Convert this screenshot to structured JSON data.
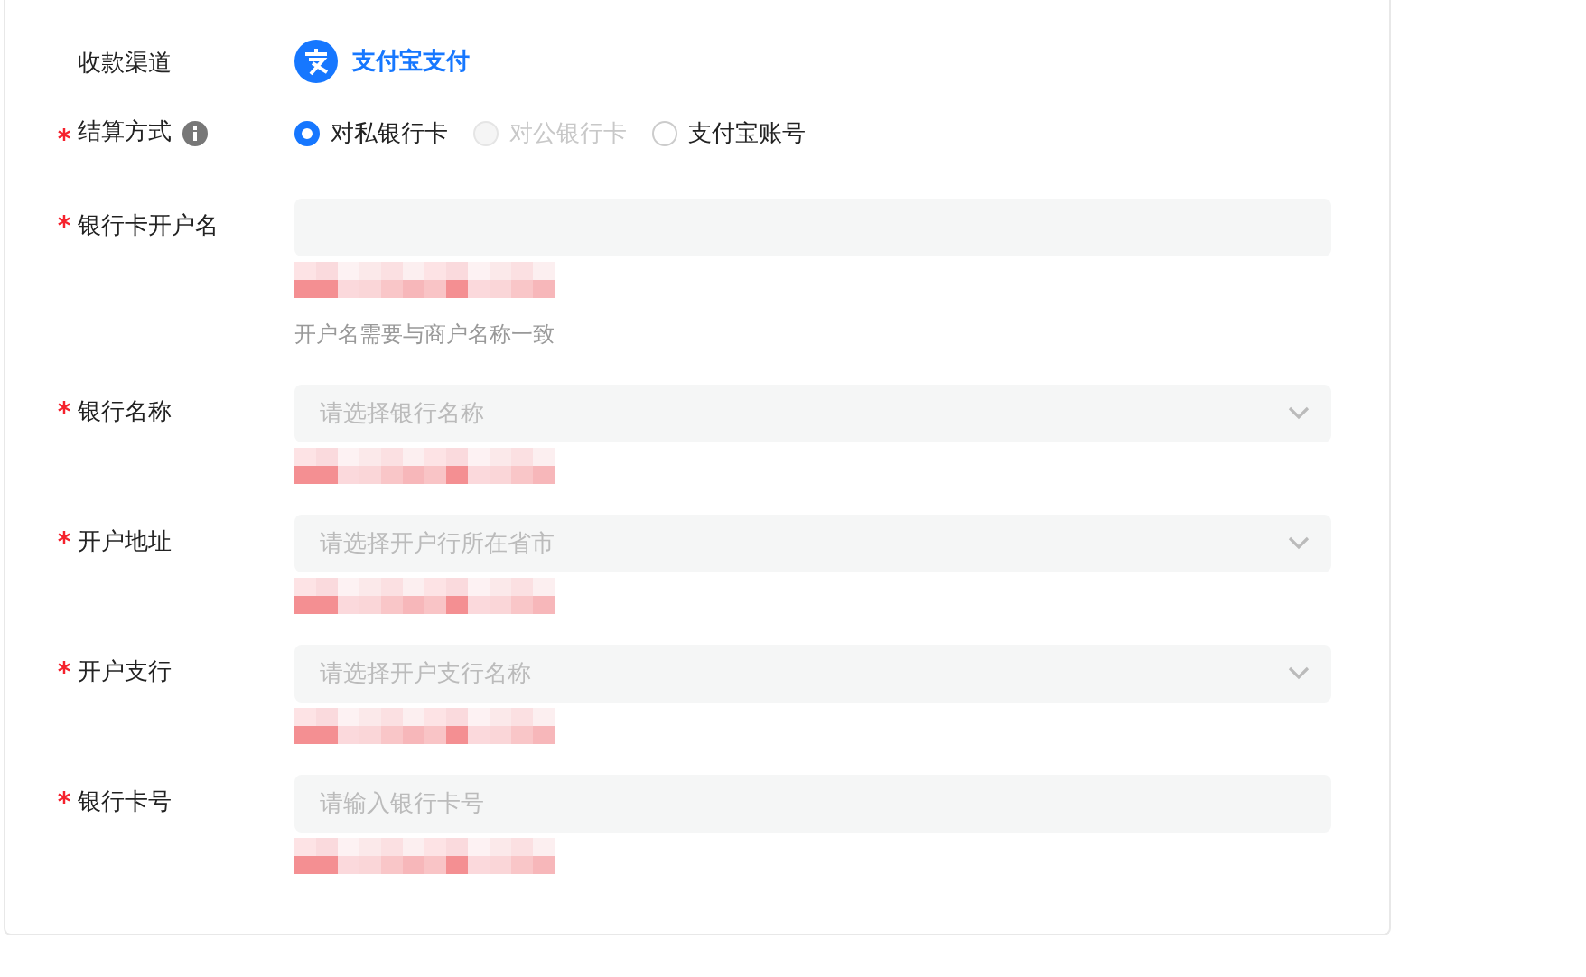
{
  "channel": {
    "label": "收款渠道",
    "value": "支付宝支付"
  },
  "settlement": {
    "label": "结算方式",
    "required": true,
    "options": [
      {
        "label": "对私银行卡",
        "selected": true,
        "disabled": false
      },
      {
        "label": "对公银行卡",
        "selected": false,
        "disabled": true
      },
      {
        "label": "支付宝账号",
        "selected": false,
        "disabled": false
      }
    ]
  },
  "fields": [
    {
      "kind": "input",
      "label": "银行卡开户名",
      "required": true,
      "error": true,
      "hint": "开户名需要与商户名称一致"
    },
    {
      "kind": "select",
      "label": "银行名称",
      "required": true,
      "placeholder": "请选择银行名称",
      "error": true
    },
    {
      "kind": "select",
      "label": "开户地址",
      "required": true,
      "placeholder": "请选择开户行所在省市",
      "error": true
    },
    {
      "kind": "select",
      "label": "开户支行",
      "required": true,
      "placeholder": "请选择开户支行名称",
      "error": true
    },
    {
      "kind": "input",
      "label": "银行卡号",
      "required": true,
      "placeholder": "请输入银行卡号",
      "error": true
    }
  ]
}
